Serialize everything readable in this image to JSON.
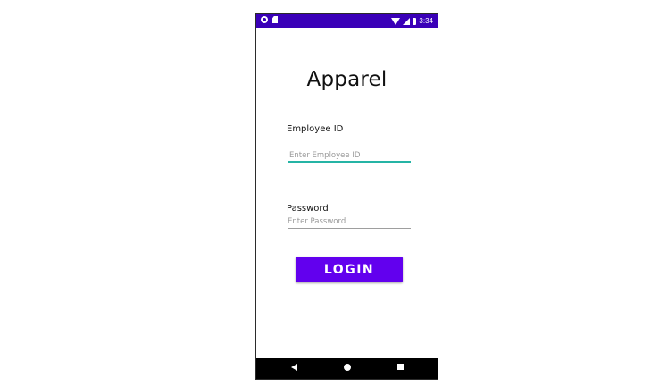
{
  "status_bar": {
    "time": "3:34",
    "background_color": "#3a00b8",
    "left_icons": [
      "settings-icon",
      "sd-card-icon"
    ],
    "right_icons": [
      "wifi-icon",
      "signal-icon",
      "battery-icon"
    ]
  },
  "app": {
    "title": "Apparel"
  },
  "form": {
    "employee_id": {
      "label": "Employee ID",
      "placeholder": "Enter Employee ID",
      "value": "",
      "focused": true,
      "focus_color": "#25b4a5"
    },
    "password": {
      "label": "Password",
      "placeholder": "Enter Password",
      "value": ""
    },
    "login": {
      "label": "LOGIN",
      "color": "#6200ee"
    }
  },
  "nav_bar": {
    "buttons": [
      "back-icon",
      "home-icon",
      "recents-icon"
    ]
  }
}
